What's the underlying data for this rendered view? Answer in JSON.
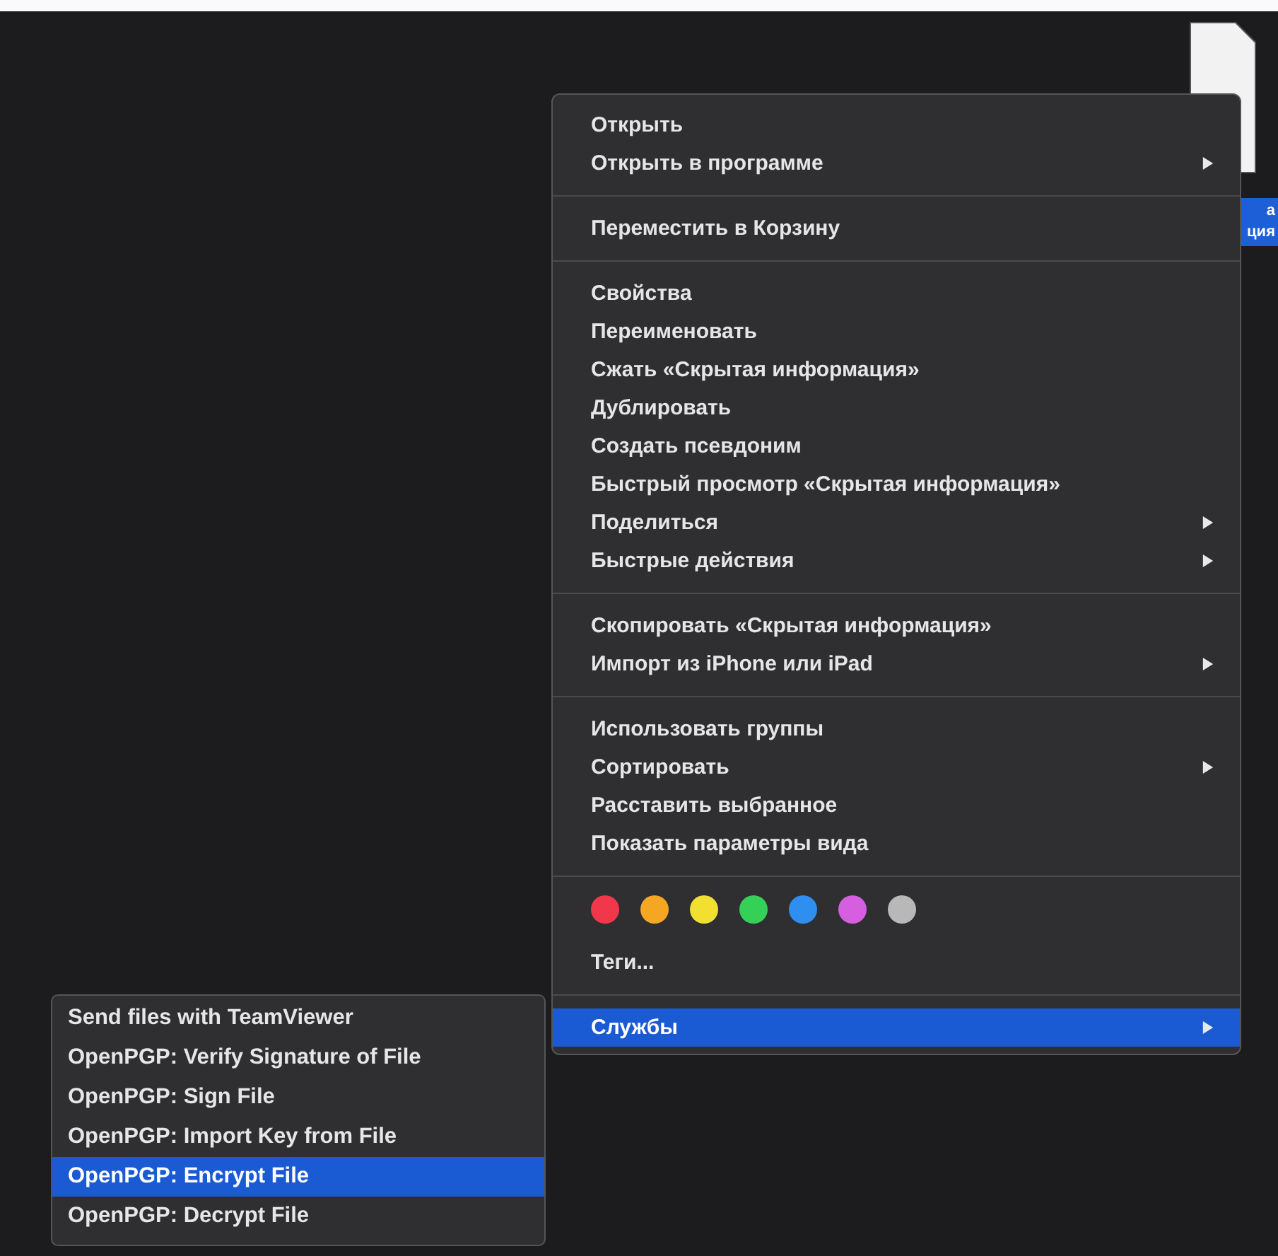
{
  "desktop_file": {
    "label_lines": [
      "а",
      "ция"
    ]
  },
  "context_menu": {
    "sections": [
      {
        "items": [
          {
            "label": "Открыть",
            "has_submenu": false,
            "selected": false
          },
          {
            "label": "Открыть в программе",
            "has_submenu": true,
            "selected": false
          }
        ]
      },
      {
        "items": [
          {
            "label": "Переместить в Корзину",
            "has_submenu": false,
            "selected": false
          }
        ]
      },
      {
        "items": [
          {
            "label": "Свойства",
            "has_submenu": false,
            "selected": false
          },
          {
            "label": "Переименовать",
            "has_submenu": false,
            "selected": false
          },
          {
            "label": "Сжать «Скрытая информация»",
            "has_submenu": false,
            "selected": false
          },
          {
            "label": "Дублировать",
            "has_submenu": false,
            "selected": false
          },
          {
            "label": "Создать псевдоним",
            "has_submenu": false,
            "selected": false
          },
          {
            "label": "Быстрый просмотр «Скрытая информация»",
            "has_submenu": false,
            "selected": false
          },
          {
            "label": "Поделиться",
            "has_submenu": true,
            "selected": false
          },
          {
            "label": "Быстрые действия",
            "has_submenu": true,
            "selected": false
          }
        ]
      },
      {
        "items": [
          {
            "label": "Скопировать «Скрытая информация»",
            "has_submenu": false,
            "selected": false
          },
          {
            "label": "Импорт из iPhone или iPad",
            "has_submenu": true,
            "selected": false
          }
        ]
      },
      {
        "items": [
          {
            "label": "Использовать группы",
            "has_submenu": false,
            "selected": false
          },
          {
            "label": "Сортировать",
            "has_submenu": true,
            "selected": false
          },
          {
            "label": "Расставить выбранное",
            "has_submenu": false,
            "selected": false
          },
          {
            "label": "Показать параметры вида",
            "has_submenu": false,
            "selected": false
          }
        ]
      },
      {
        "tags": [
          {
            "color": "#f0384a"
          },
          {
            "color": "#f5a623"
          },
          {
            "color": "#f2e030"
          },
          {
            "color": "#34d058"
          },
          {
            "color": "#2f8ff0"
          },
          {
            "color": "#d65ee0"
          },
          {
            "color": "#b8b8b8"
          }
        ],
        "items": [
          {
            "label": "Теги...",
            "has_submenu": false,
            "selected": false
          }
        ]
      },
      {
        "items": [
          {
            "label": "Службы",
            "has_submenu": true,
            "selected": true
          }
        ]
      }
    ]
  },
  "services_menu": {
    "items": [
      {
        "label": "Send files with TeamViewer",
        "selected": false
      },
      {
        "label": "OpenPGP: Verify Signature of File",
        "selected": false
      },
      {
        "label": "OpenPGP: Sign File",
        "selected": false
      },
      {
        "label": "OpenPGP: Import Key from File",
        "selected": false
      },
      {
        "label": "OpenPGP: Encrypt File",
        "selected": true
      },
      {
        "label": "OpenPGP: Decrypt File",
        "selected": false
      }
    ]
  }
}
